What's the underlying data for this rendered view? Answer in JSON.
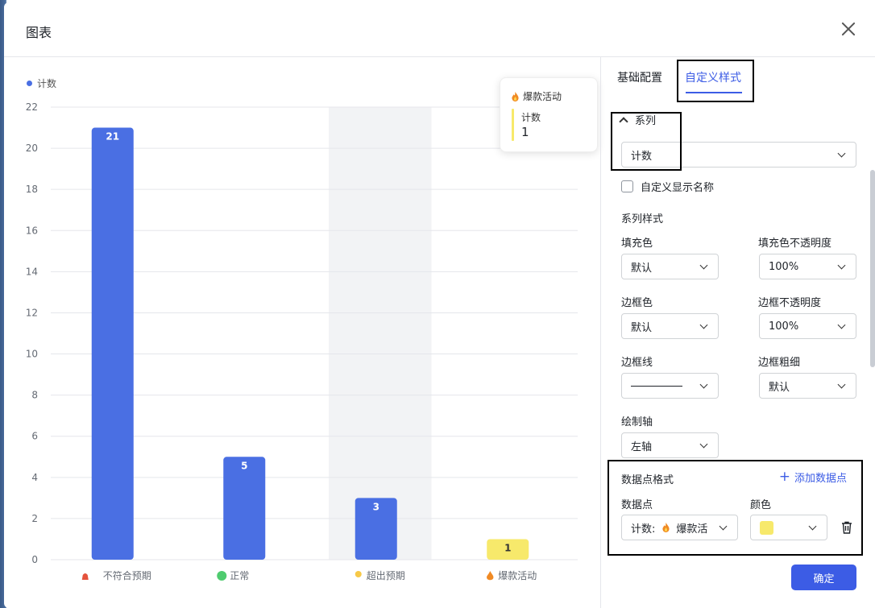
{
  "modal": {
    "title": "图表"
  },
  "chart_data": {
    "type": "bar",
    "legend": [
      "计数"
    ],
    "categories": [
      "不符合预期",
      "正常",
      "超出预期",
      "爆款活动"
    ],
    "series": [
      {
        "name": "计数",
        "values": [
          21,
          5,
          3,
          1
        ]
      }
    ],
    "bar_colors": [
      "#4a6fe3",
      "#4a6fe3",
      "#4a6fe3",
      "#f7e96b"
    ],
    "ylim": [
      0,
      22
    ],
    "yticks": [
      "0",
      "2",
      "4",
      "6",
      "8",
      "10",
      "12",
      "14",
      "16",
      "18",
      "20",
      "22"
    ],
    "highlighted_category": "超出预期",
    "category_icons": [
      "alarm-icon",
      "green-dot-icon",
      "bulb-icon",
      "flame-icon"
    ]
  },
  "tooltip": {
    "title": "爆款活动",
    "label": "计数",
    "value": "1"
  },
  "panel": {
    "tabs": {
      "basic": "基础配置",
      "custom": "自定义样式"
    },
    "series_section": "系列",
    "series_select": "计数",
    "custom_name_checkbox": "自定义显示名称",
    "series_style": "系列样式",
    "fill_color_label": "填充色",
    "fill_color_value": "默认",
    "fill_opacity_label": "填充色不透明度",
    "fill_opacity_value": "100%",
    "border_color_label": "边框色",
    "border_color_value": "默认",
    "border_opacity_label": "边框不透明度",
    "border_opacity_value": "100%",
    "border_line_label": "边框线",
    "border_width_label": "边框粗细",
    "border_width_value": "默认",
    "axis_label": "绘制轴",
    "axis_value": "左轴",
    "datapoint_section": "数据点格式",
    "add_datapoint": "添加数据点",
    "datapoint_label": "数据点",
    "datapoint_value_prefix": "计数:",
    "datapoint_value_name": "爆款活",
    "color_label": "颜色",
    "confirm": "确定"
  }
}
